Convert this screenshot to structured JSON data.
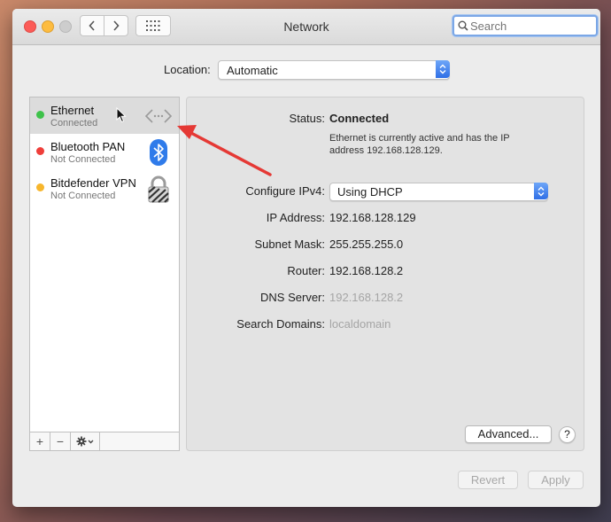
{
  "window": {
    "title": "Network"
  },
  "search": {
    "placeholder": "Search",
    "value": ""
  },
  "location": {
    "label": "Location:",
    "value": "Automatic"
  },
  "services": [
    {
      "name": "Ethernet",
      "status": "Connected",
      "dot_color": "#3ec24a",
      "icon": "ethernet-icon"
    },
    {
      "name": "Bluetooth PAN",
      "status": "Not Connected",
      "dot_color": "#ef3e3a",
      "icon": "bluetooth-icon"
    },
    {
      "name": "Bitdefender VPN",
      "status": "Not Connected",
      "dot_color": "#f7b62c",
      "icon": "vpn-lock-icon"
    }
  ],
  "toolbar": {
    "add": "+",
    "remove": "−",
    "gear_icon": "gear-icon"
  },
  "detail": {
    "status_label": "Status:",
    "status_value": "Connected",
    "status_description": "Ethernet is currently active and has the IP address 192.168.128.129.",
    "configure_label": "Configure IPv4:",
    "configure_value": "Using DHCP",
    "ip_label": "IP Address:",
    "ip_value": "192.168.128.129",
    "subnet_label": "Subnet Mask:",
    "subnet_value": "255.255.255.0",
    "router_label": "Router:",
    "router_value": "192.168.128.2",
    "dns_label": "DNS Server:",
    "dns_value": "192.168.128.2",
    "search_domains_label": "Search Domains:",
    "search_domains_value": "localdomain"
  },
  "buttons": {
    "advanced": "Advanced...",
    "help": "?",
    "revert": "Revert",
    "apply": "Apply"
  },
  "colors": {
    "accent": "#3478f6",
    "annotation_arrow": "#e53935"
  }
}
